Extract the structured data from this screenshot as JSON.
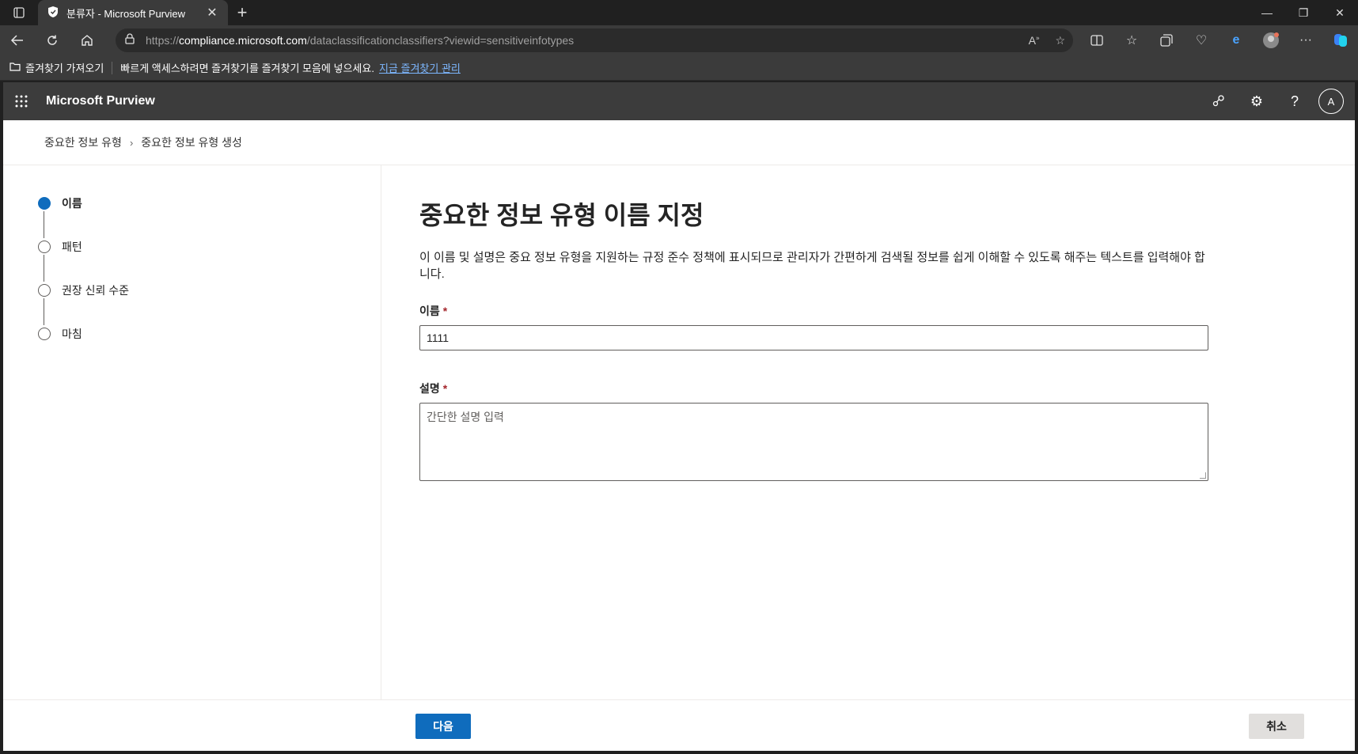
{
  "browser": {
    "tab_title": "분류자 - Microsoft Purview",
    "url_prefix": "https://",
    "url_host": "compliance.microsoft.com",
    "url_path": "/dataclassificationclassifiers?viewid=sensitiveinfotypes",
    "favbar": {
      "import_label": "즐겨찾기 가져오기",
      "message": "빠르게 액세스하려면 즐겨찾기를 즐겨찾기 모음에 넣으세요.",
      "manage_link": "지금 즐겨찾기 관리"
    }
  },
  "app": {
    "brand": "Microsoft Purview",
    "avatar_initial": "A"
  },
  "breadcrumb": {
    "items": [
      "중요한 정보 유형",
      "중요한 정보 유형 생성"
    ]
  },
  "steps": [
    {
      "label": "이름",
      "active": true
    },
    {
      "label": "패턴",
      "active": false
    },
    {
      "label": "권장 신뢰 수준",
      "active": false
    },
    {
      "label": "마침",
      "active": false
    }
  ],
  "form": {
    "title": "중요한 정보 유형 이름 지정",
    "description": "이 이름 및 설명은 중요 정보 유형을 지원하는 규정 준수 정책에 표시되므로 관리자가 간편하게 검색될 정보를 쉽게 이해할 수 있도록 해주는 텍스트를 입력해야 합니다.",
    "name_label": "이름",
    "name_value": "1111",
    "desc_label": "설명",
    "desc_placeholder": "간단한 설명 입력",
    "required_mark": "*"
  },
  "footer": {
    "next_label": "다음",
    "cancel_label": "취소"
  },
  "colors": {
    "accent": "#0f6cbd",
    "header_bg": "#3c3c3c"
  }
}
